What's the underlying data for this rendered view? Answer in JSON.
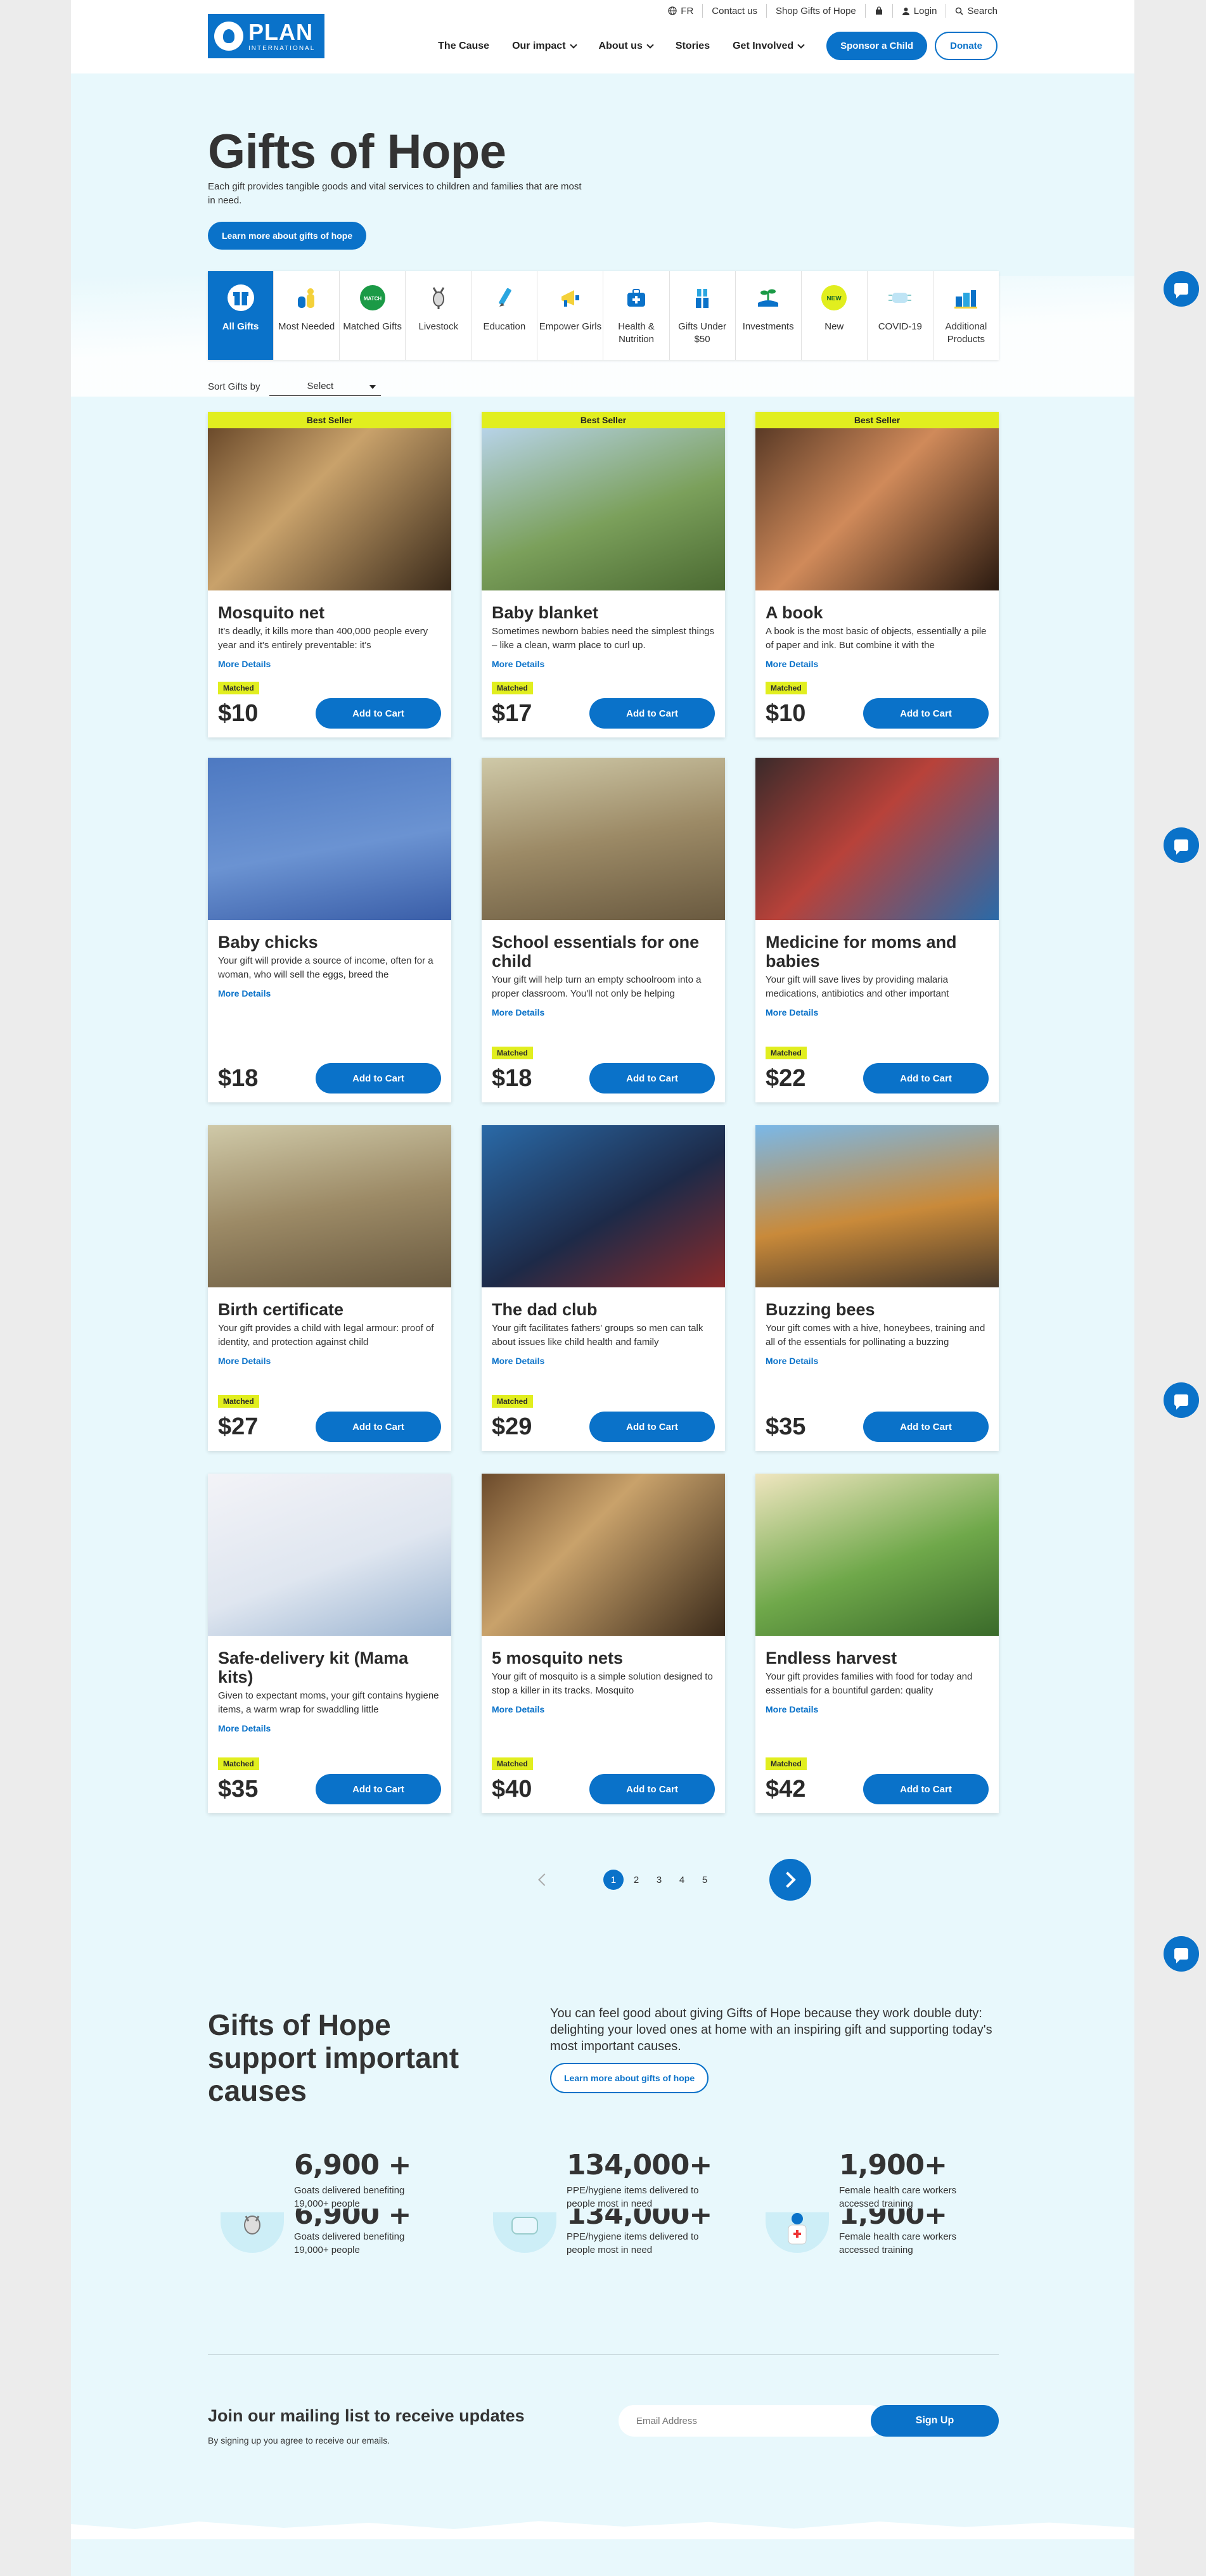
{
  "utility": {
    "lang": "FR",
    "contact": "Contact us",
    "shop": "Shop Gifts of Hope",
    "login": "Login",
    "search": "Search"
  },
  "logo": {
    "main": "PLAN",
    "sub": "INTERNATIONAL"
  },
  "nav": {
    "items": [
      "The Cause",
      "Our impact",
      "About us",
      "Stories",
      "Get Involved"
    ],
    "sponsor": "Sponsor a Child",
    "donate": "Donate"
  },
  "hero": {
    "title": "Gifts of Hope",
    "desc": "Each gift provides tangible goods and vital services to children and families that are most in need.",
    "cta": "Learn more about gifts of hope"
  },
  "categories": [
    {
      "label": "All Gifts",
      "icon": "gift-icon"
    },
    {
      "label": "Most Needed",
      "icon": "hands-icon"
    },
    {
      "label": "Matched Gifts",
      "icon": "matched-badge-icon",
      "badge": "MATCH"
    },
    {
      "label": "Livestock",
      "icon": "goat-icon"
    },
    {
      "label": "Education",
      "icon": "pencil-icon"
    },
    {
      "label": "Empower Girls",
      "icon": "megaphone-icon"
    },
    {
      "label": "Health & Nutrition",
      "icon": "medical-bag-icon"
    },
    {
      "label": "Gifts Under $50",
      "icon": "gift-stack-icon"
    },
    {
      "label": "Investments",
      "icon": "plant-hand-icon"
    },
    {
      "label": "New",
      "icon": "new-badge-icon",
      "badge": "NEW"
    },
    {
      "label": "COVID-19",
      "icon": "mask-icon"
    },
    {
      "label": "Additional Products",
      "icon": "boxes-icon"
    }
  ],
  "sort": {
    "label": "Sort Gifts by",
    "value": "Select"
  },
  "products": [
    {
      "badge": "Best Seller",
      "title": "Mosquito net",
      "desc": "It's deadly, it kills more than 400,000 people every year and it's entirely preventable: it's",
      "more": "More Details",
      "matched": "Matched",
      "price": "$10",
      "cta": "Add to Cart"
    },
    {
      "badge": "Best Seller",
      "title": "Baby blanket",
      "desc": "Sometimes newborn babies need the simplest things – like a clean, warm place to curl up.",
      "more": "More Details",
      "matched": "Matched",
      "price": "$17",
      "cta": "Add to Cart"
    },
    {
      "badge": "Best Seller",
      "title": "A book",
      "desc": "A book is the most basic of objects, essentially a pile of paper and ink. But combine it with the",
      "more": "More Details",
      "matched": "Matched",
      "price": "$10",
      "cta": "Add to Cart"
    },
    {
      "badge": "",
      "title": "Baby chicks",
      "desc": "Your gift will provide a source of income, often for a woman, who will sell the eggs, breed the",
      "more": "More Details",
      "matched": "",
      "price": "$18",
      "cta": "Add to Cart"
    },
    {
      "badge": "",
      "title": "School essentials for one child",
      "desc": "Your gift will help turn an empty schoolroom into a proper classroom. You'll not only be helping",
      "more": "More Details",
      "matched": "Matched",
      "price": "$18",
      "cta": "Add to Cart"
    },
    {
      "badge": "",
      "title": "Medicine for moms and babies",
      "desc": "Your gift will save lives by providing malaria medications, antibiotics and other important",
      "more": "More Details",
      "matched": "Matched",
      "price": "$22",
      "cta": "Add to Cart"
    },
    {
      "badge": "",
      "title": "Birth certificate",
      "desc": "Your gift provides a child with legal armour: proof of identity, and protection against child",
      "more": "More Details",
      "matched": "Matched",
      "price": "$27",
      "cta": "Add to Cart"
    },
    {
      "badge": "",
      "title": "The dad club",
      "desc": "Your gift facilitates fathers' groups so men can talk about issues like child health and family",
      "more": "More Details",
      "matched": "Matched",
      "price": "$29",
      "cta": "Add to Cart"
    },
    {
      "badge": "",
      "title": "Buzzing bees",
      "desc": "Your gift comes with a hive, honeybees, training and all of the essentials for pollinating a buzzing",
      "more": "More Details",
      "matched": "",
      "price": "$35",
      "cta": "Add to Cart"
    },
    {
      "badge": "",
      "title": "Safe-delivery kit (Mama kits)",
      "desc": "Given to expectant moms, your gift contains hygiene items, a warm wrap for swaddling little",
      "more": "More Details",
      "matched": "Matched",
      "price": "$35",
      "cta": "Add to Cart"
    },
    {
      "badge": "",
      "title": "5 mosquito nets",
      "desc": "Your gift of mosquito is a simple solution designed to stop a killer in its tracks. Mosquito",
      "more": "More Details",
      "matched": "Matched",
      "price": "$40",
      "cta": "Add to Cart"
    },
    {
      "badge": "",
      "title": "Endless harvest",
      "desc": "Your gift provides families with food for today and essentials for a bountiful garden: quality",
      "more": "More Details",
      "matched": "Matched",
      "price": "$42",
      "cta": "Add to Cart"
    }
  ],
  "pagination": {
    "pages": [
      "1",
      "2",
      "3",
      "4",
      "5"
    ],
    "current": 1
  },
  "causes": {
    "title": "Gifts of Hope support important causes",
    "text": "You can feel good about giving Gifts of Hope because they work double duty: delighting your loved ones at home with an inspiring gift and supporting today's most important causes.",
    "cta": "Learn more about gifts of hope",
    "stats": [
      {
        "num": "6,900 +",
        "label": "Goats delivered benefiting 19,000+ people",
        "icon": "goat-icon"
      },
      {
        "num": "134,000+",
        "label": "PPE/hygiene items delivered to people most in need",
        "icon": "mask-icon"
      },
      {
        "num": "1,900+",
        "label": "Female health care workers accessed training",
        "icon": "health-worker-icon"
      }
    ]
  },
  "mailing": {
    "title": "Join our mailing list to receive updates",
    "note": "By signing up you agree to receive our emails.",
    "placeholder": "Email Address",
    "cta": "Sign Up"
  },
  "colors": {
    "primary": "#0a72c9",
    "accent": "#e1ee1f",
    "tint": "#e8f8fc"
  }
}
